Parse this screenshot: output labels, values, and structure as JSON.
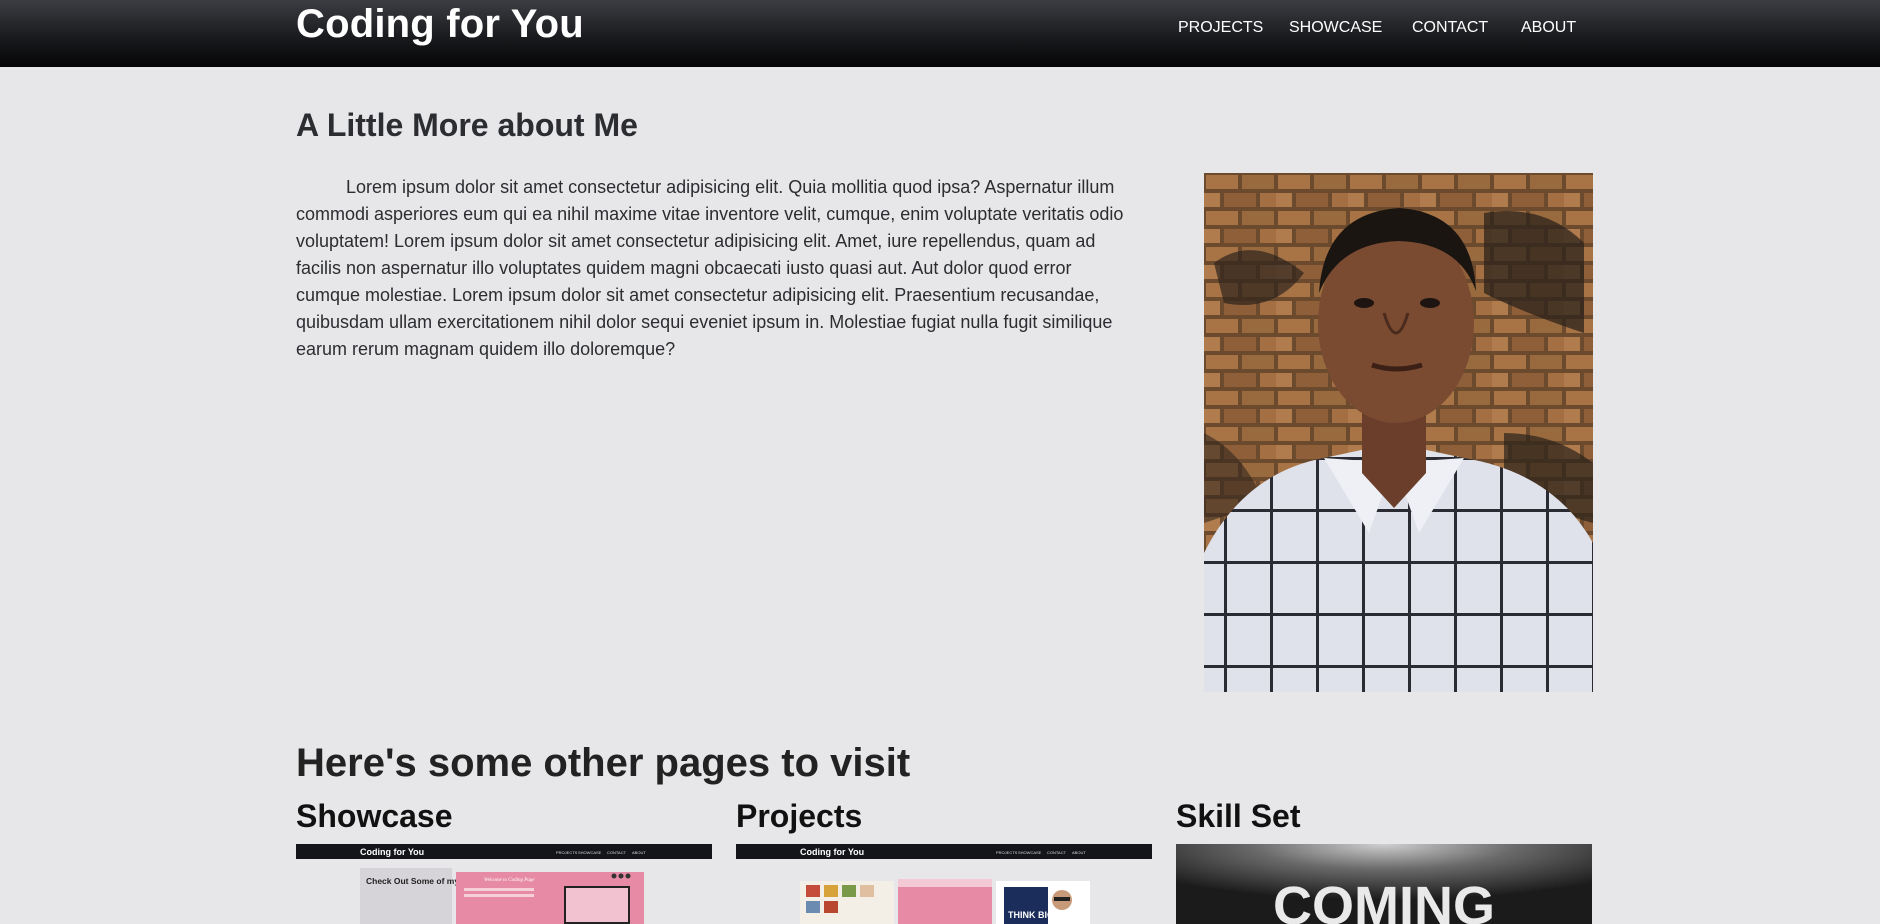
{
  "navbar": {
    "brand": "Coding for You",
    "links": [
      "PROJECTS",
      "SHOWCASE",
      "CONTACT",
      "ABOUT"
    ]
  },
  "about": {
    "heading": "A Little More about Me",
    "paragraph": "Lorem ipsum dolor sit amet consectetur adipisicing elit. Quia mollitia quod ipsa? Aspernatur illum commodi asperiores eum qui ea nihil maxime vitae inventore velit, cumque, enim voluptate veritatis odio voluptatem! Lorem ipsum dolor sit amet consectetur adipisicing elit. Amet, iure repellendus, quam ad facilis non aspernatur illo voluptates quidem magni obcaecati iusto quasi aut. Aut dolor quod error cumque molestiae. Lorem ipsum dolor sit amet consectetur adipisicing elit. Praesentium recusandae, quibusdam ullam exercitationem nihil dolor sequi eveniet ipsum in. Molestiae fugiat nulla fugit similique earum rerum magnam quidem illo doloremque?"
  },
  "other_pages": {
    "heading": "Here's some other pages to visit",
    "cards": [
      {
        "title": "Showcase",
        "thumb_brand": "Coding for You",
        "thumb_nav": [
          "PROJECTS",
          "SHOWCASE",
          "CONTACT",
          "ABOUT"
        ],
        "thumb_caption": "Check Out Some of my Past Work!",
        "thumb_panel_title": "Welcome to Coding Page"
      },
      {
        "title": "Projects",
        "thumb_brand": "Coding for You",
        "thumb_nav": [
          "PROJECTS",
          "SHOWCASE",
          "CONTACT",
          "ABOUT"
        ],
        "thumb_caption": "THINK BIG."
      },
      {
        "title": "Skill Set",
        "thumb_caption": "COMING"
      }
    ]
  },
  "colors": {
    "page_bg": "#e7e6e8",
    "navbar_dark": "#0a0a0b",
    "pink": "#e68aa6"
  }
}
